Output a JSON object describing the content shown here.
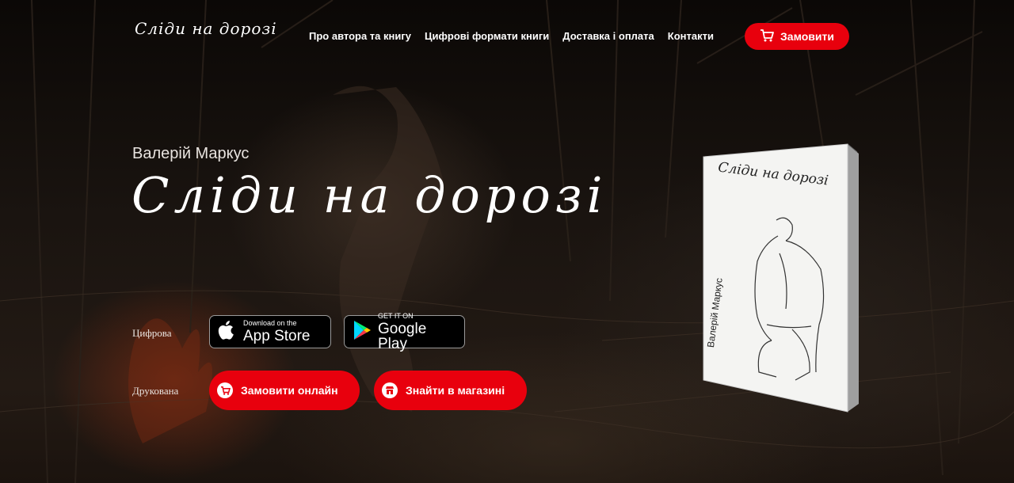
{
  "header": {
    "logo_text": "Сліди на дорозі",
    "nav": [
      {
        "label": "Про автора та книгу"
      },
      {
        "label": "Цифрові формати книги"
      },
      {
        "label": "Доставка і оплата"
      },
      {
        "label": "Контакти"
      }
    ],
    "order_label": "Замовити"
  },
  "hero": {
    "author": "Валерій Маркус",
    "title": "Сліди на дорозі",
    "digital_label": "Цифрова",
    "printed_label": "Друкована",
    "app_store": {
      "small": "Download on the",
      "big": "App Store"
    },
    "google_play": {
      "small": "GET IT ON",
      "big": "Google Play"
    },
    "order_online_label": "Замовити онлайн",
    "find_in_store_label": "Знайти в магазині"
  },
  "book": {
    "cover_title": "Сліди на дорозі",
    "cover_author": "Валерій Маркус"
  },
  "colors": {
    "accent": "#e8000d",
    "background": "#120d0a"
  }
}
